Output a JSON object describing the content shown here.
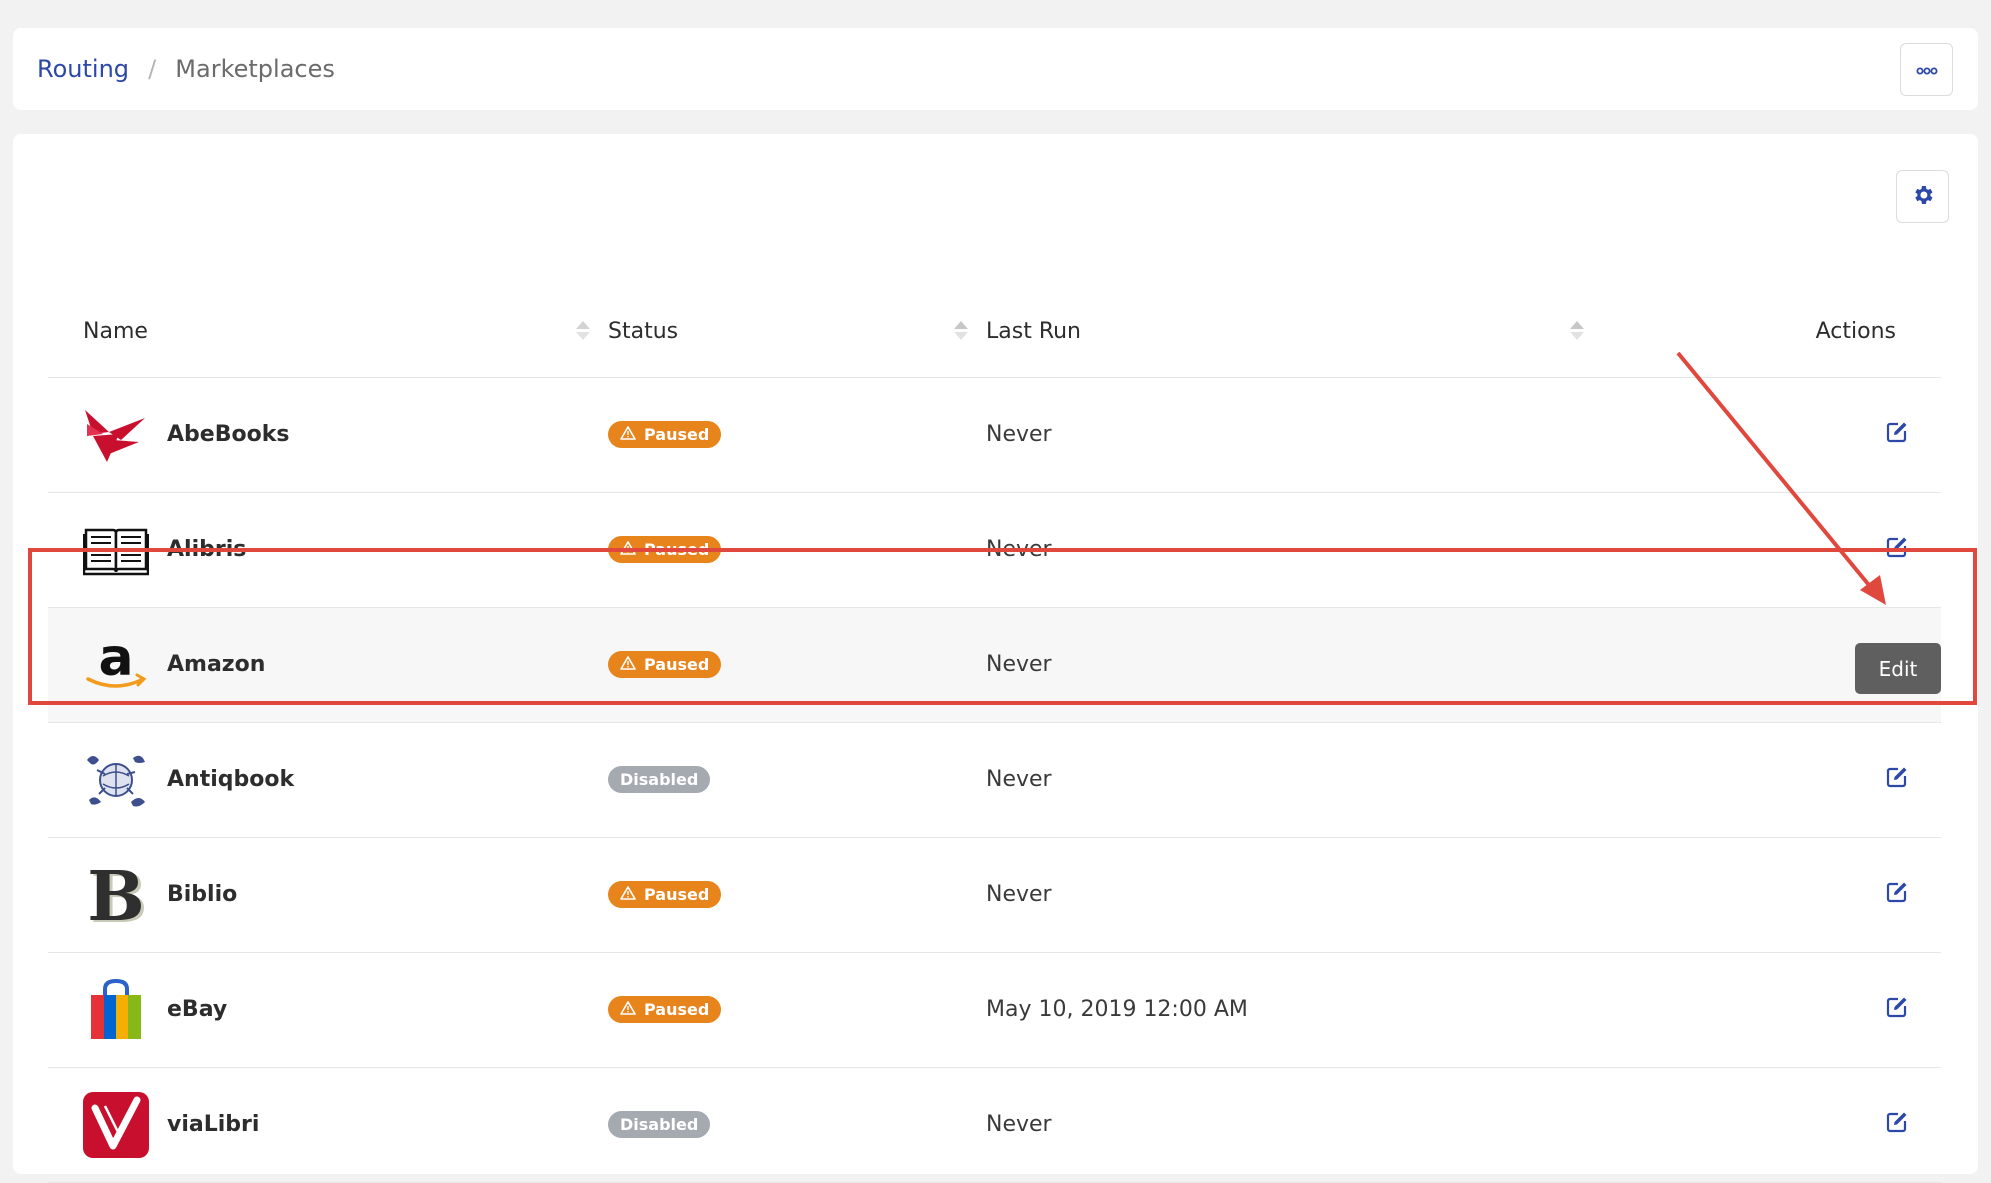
{
  "breadcrumb": {
    "root": "Routing",
    "separator": "/",
    "current": "Marketplaces"
  },
  "columns": {
    "name": "Name",
    "status": "Status",
    "last_run": "Last Run",
    "actions": "Actions"
  },
  "rows": [
    {
      "name": "AbeBooks",
      "logo": "abebooks-logo",
      "status": "Paused",
      "last_run": "Never"
    },
    {
      "name": "Alibris",
      "logo": "alibris-logo",
      "status": "Paused",
      "last_run": "Never"
    },
    {
      "name": "Amazon",
      "logo": "amazon-logo",
      "status": "Paused",
      "last_run": "Never"
    },
    {
      "name": "Antiqbook",
      "logo": "antiqbook-logo",
      "status": "Disabled",
      "last_run": "Never"
    },
    {
      "name": "Biblio",
      "logo": "biblio-logo",
      "status": "Paused",
      "last_run": "Never"
    },
    {
      "name": "eBay",
      "logo": "ebay-logo",
      "status": "Paused",
      "last_run": "May 10, 2019 12:00 AM"
    },
    {
      "name": "viaLibri",
      "logo": "vialibri-logo",
      "status": "Disabled",
      "last_run": "Never"
    }
  ],
  "tooltip": {
    "text": "Edit"
  },
  "colors": {
    "accent": "#2c48a8",
    "paused": "#e8841c",
    "disabled": "#a5aab1",
    "annotation": "#e0483e"
  }
}
